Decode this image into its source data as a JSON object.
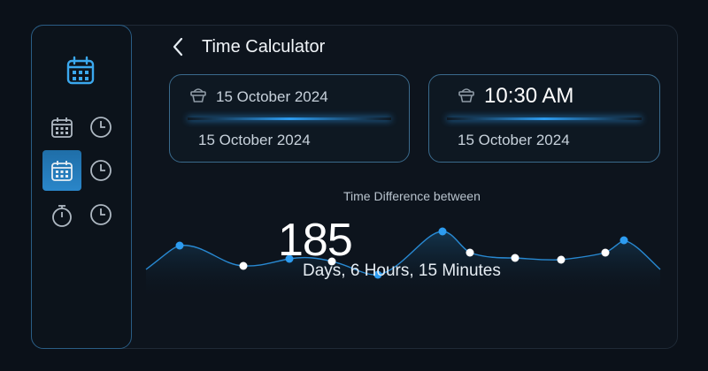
{
  "header": {
    "title": "Time Calculator"
  },
  "icons": {
    "back": "chevron-left-icon",
    "calendar": "calendar-icon",
    "clock": "clock-icon",
    "stopwatch": "stopwatch-icon",
    "basket": "basket-icon"
  },
  "cards": [
    {
      "top_value": "15 October 2024",
      "bottom_value": "15 October 2024"
    },
    {
      "top_value": "10:30 AM",
      "bottom_value": "15 October 2024"
    }
  ],
  "result": {
    "label": "Time Difference between",
    "days": "185",
    "detail": "Days, 6 Hours, 15 Minutes"
  },
  "colors": {
    "background": "#0b1119",
    "accent": "#2d9cf0",
    "active_item": "#2a86c9",
    "card_border": "#3a6a8c"
  }
}
